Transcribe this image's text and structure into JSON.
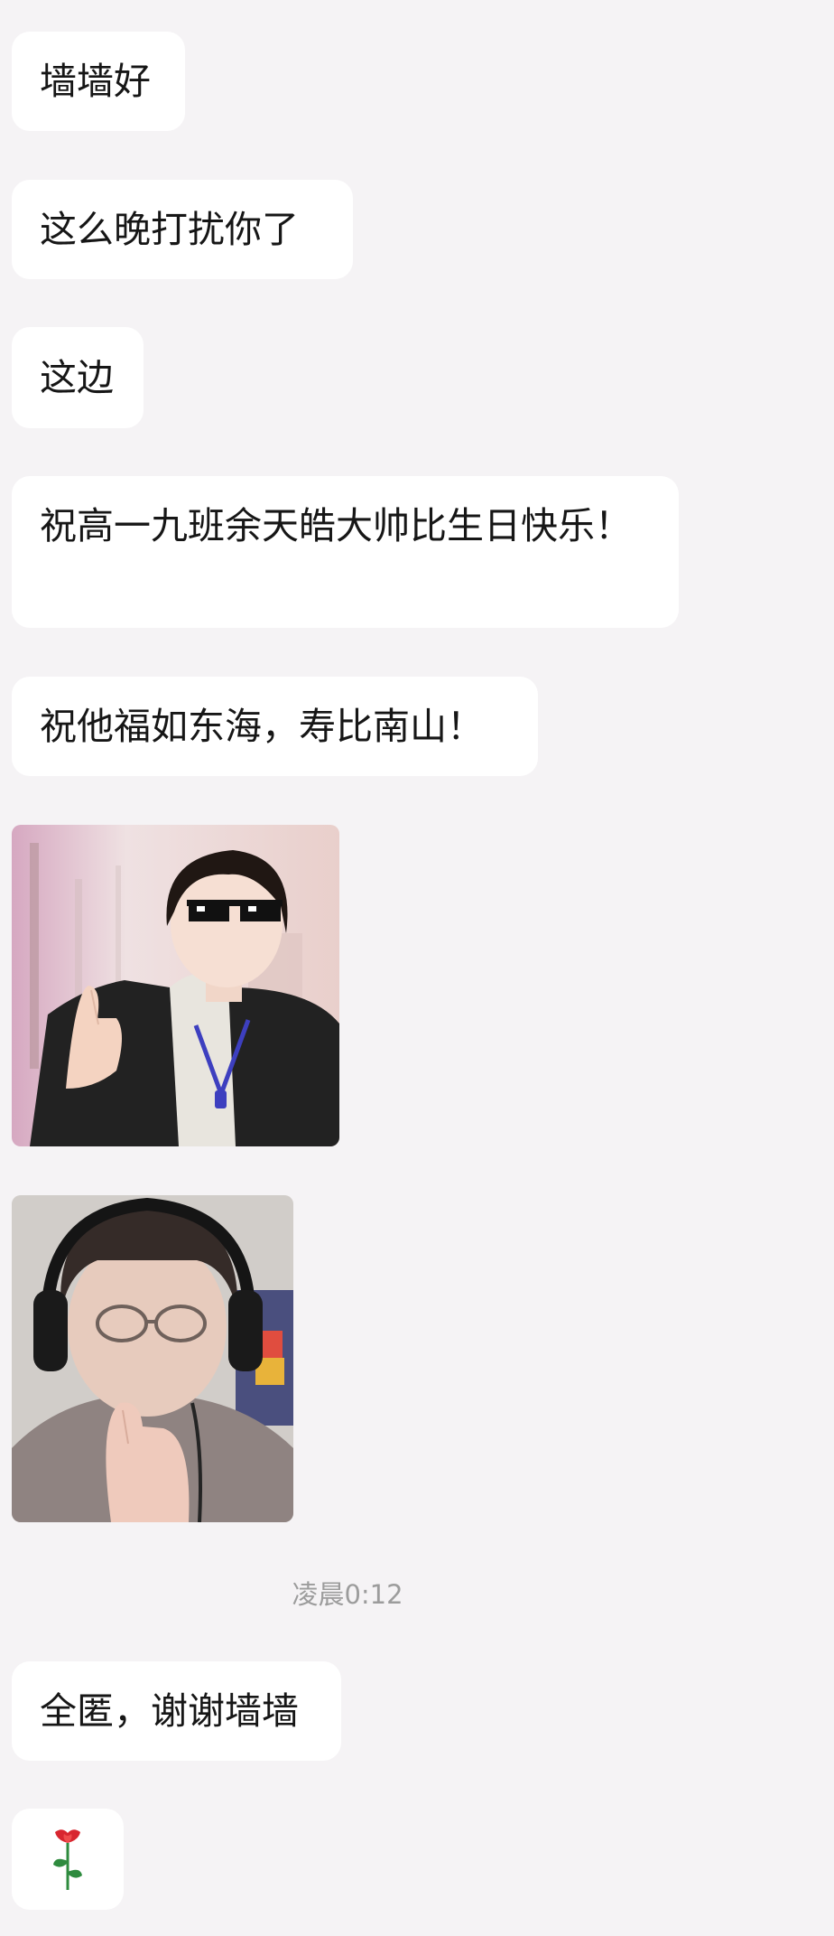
{
  "messages": [
    {
      "text": "墙墙好"
    },
    {
      "text": "这么晚打扰你了"
    },
    {
      "text": "这边"
    },
    {
      "text": "祝高一九班余天皓大帅比生日快乐！"
    },
    {
      "text": "祝他福如东海，寿比南山！"
    }
  ],
  "timestamp": "凌晨0:12",
  "reply": {
    "text": "全匿，谢谢墙墙"
  },
  "sticker": {
    "icon": "rose-icon"
  },
  "colors": {
    "background": "#f5f3f5",
    "bubble": "#ffffff",
    "text": "#161616",
    "timestamp": "#9c9c9c"
  }
}
